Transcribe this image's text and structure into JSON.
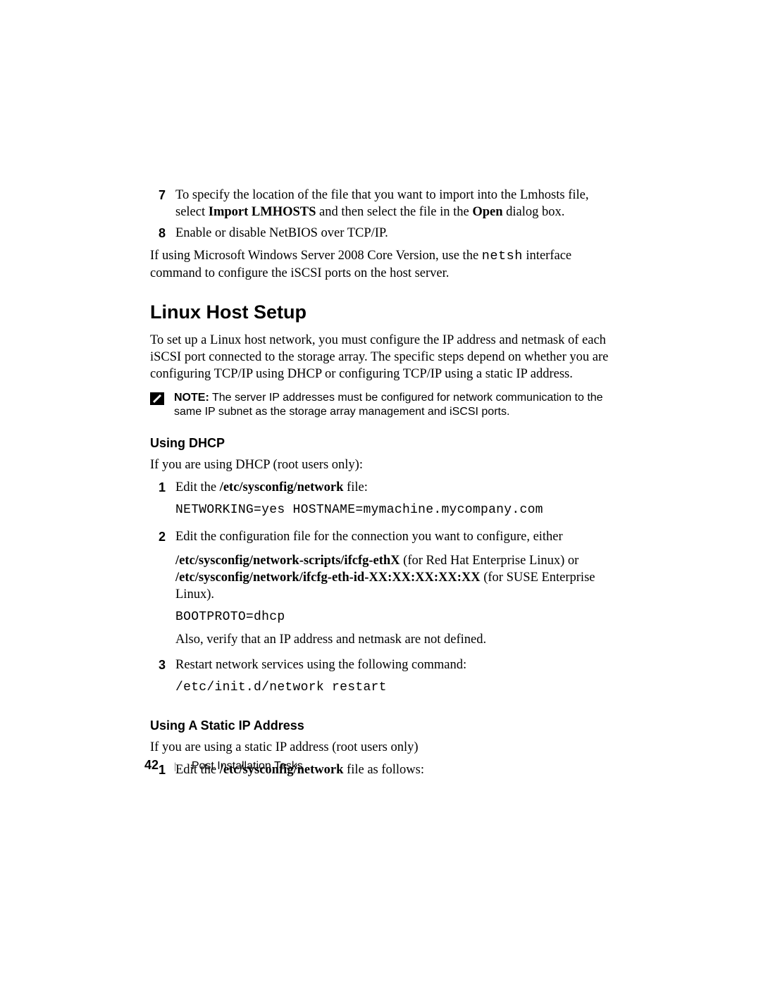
{
  "steps_top": [
    {
      "marker": "7",
      "segments": [
        {
          "t": "To specify the location of the file that you want to import into the Lmhosts file, select "
        },
        {
          "t": "Import LMHOSTS",
          "b": true
        },
        {
          "t": " and then select the file in the "
        },
        {
          "t": "Open",
          "b": true
        },
        {
          "t": " dialog box."
        }
      ]
    },
    {
      "marker": "8",
      "segments": [
        {
          "t": "Enable or disable NetBIOS over TCP/IP."
        }
      ]
    }
  ],
  "para_after_top": {
    "segments": [
      {
        "t": "If using Microsoft Windows Server 2008 Core Version, use the "
      },
      {
        "t": "netsh",
        "mono": true
      },
      {
        "t": " interface command to configure the iSCSI ports on the host server."
      }
    ]
  },
  "section_heading": "Linux Host Setup",
  "section_para": "To set up a Linux host network, you must configure the IP address and netmask of each iSCSI port connected to the storage array. The specific steps depend on whether you are configuring TCP/IP using DHCP or configuring TCP/IP using a static IP address.",
  "note": {
    "label": "NOTE:",
    "text": " The server IP addresses must be configured for network communication to the same IP subnet as the storage array management and iSCSI ports."
  },
  "dhcp": {
    "heading": "Using DHCP",
    "intro": "If you are using DHCP (root users only):",
    "steps": [
      {
        "marker": "1",
        "line": {
          "segments": [
            {
              "t": "Edit the "
            },
            {
              "t": "/etc/sysconfig/network",
              "b": true
            },
            {
              "t": " file:"
            }
          ]
        },
        "code": "NETWORKING=yes HOSTNAME=mymachine.mycompany.com"
      },
      {
        "marker": "2",
        "line": {
          "segments": [
            {
              "t": "Edit the configuration file for the connection you want to configure, either"
            }
          ]
        },
        "para2": {
          "segments": [
            {
              "t": "/etc/sysconfig/network-scripts/ifcfg-ethX",
              "b": true
            },
            {
              "t": " (for Red Hat Enterprise Linux) or "
            },
            {
              "t": "/etc/sysconfig/network/ifcfg-eth-id-XX:XX:XX:XX:XX",
              "b": true
            },
            {
              "t": " (for SUSE Enterprise Linux)."
            }
          ]
        },
        "code": "BOOTPROTO=dhcp",
        "after": "Also, verify that an IP address and netmask are not defined."
      },
      {
        "marker": "3",
        "line": {
          "segments": [
            {
              "t": "Restart network services using the following command:"
            }
          ]
        },
        "code": "/etc/init.d/network  restart"
      }
    ]
  },
  "static": {
    "heading": "Using A Static IP Address",
    "intro": "If you are using a static IP address (root users only)",
    "steps": [
      {
        "marker": "1",
        "line": {
          "segments": [
            {
              "t": "Edit the "
            },
            {
              "t": "/etc/sysconfig/network",
              "b": true
            },
            {
              "t": " file as follows:"
            }
          ]
        }
      }
    ]
  },
  "footer": {
    "page": "42",
    "sep": "|",
    "label": "Post Installation Tasks"
  }
}
